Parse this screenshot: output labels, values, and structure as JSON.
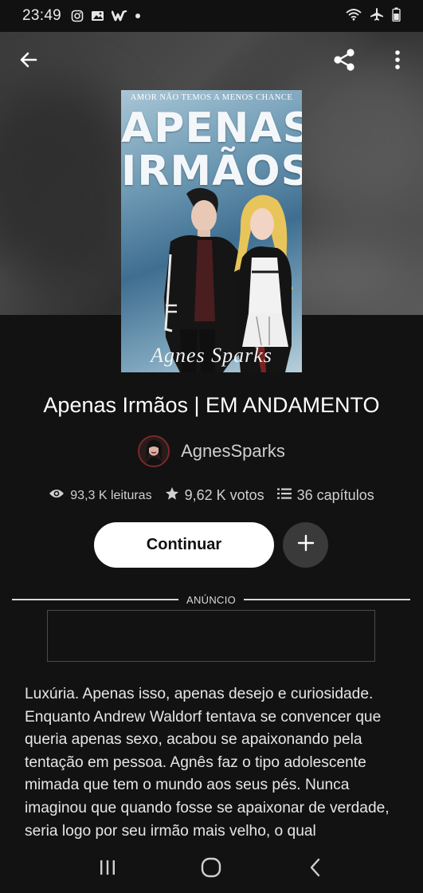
{
  "status_bar": {
    "time": "23:49",
    "left_icons": [
      "instagram-icon",
      "gallery-icon",
      "wattpad-icon",
      "notification-dot-icon"
    ],
    "right_icons": [
      "wifi-icon",
      "airplane-mode-icon",
      "battery-icon"
    ]
  },
  "header": {
    "back_icon": "arrow-left-icon",
    "share_icon": "share-icon",
    "more_icon": "more-vertical-icon"
  },
  "cover": {
    "tagline": "AMOR NÃO TEMOS A MENOS CHANCE",
    "title_line1": "APENAS",
    "title_line2": "IRMÃOS",
    "author_script": "Agnes Sparks"
  },
  "book": {
    "title": "Apenas Irmãos | EM ANDAMENTO",
    "author": "AgnesSparks"
  },
  "stats": {
    "reads": "93,3 K leituras",
    "votes": "9,62 K votos",
    "chapters": "36 capítulos"
  },
  "actions": {
    "continue_label": "Continuar"
  },
  "ad": {
    "label": "ANÚNCIO"
  },
  "description": "Luxúria. Apenas isso, apenas desejo e curiosidade. Enquanto Andrew Waldorf tentava se convencer que queria apenas sexo, acabou se apaixonando pela tentação em pessoa. Agnês faz o tipo adolescente mimada que tem o mundo aos seus pés. Nunca imaginou que quando fosse se apaixonar de verdade, seria logo por seu irmão mais velho, o qual",
  "nav_bar": {
    "icons": [
      "recent-apps-icon",
      "home-icon",
      "back-icon"
    ]
  }
}
